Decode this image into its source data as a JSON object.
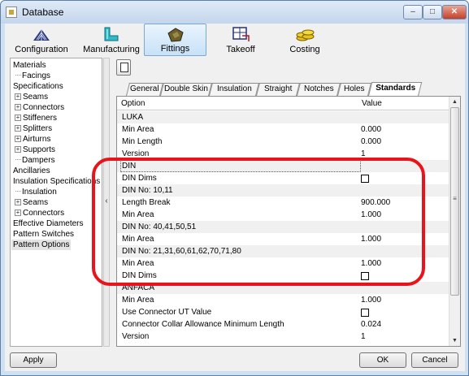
{
  "window": {
    "title": "Database",
    "controls": {
      "minimize": "–",
      "maximize": "□",
      "close": "✕"
    }
  },
  "toolbar": {
    "buttons": [
      {
        "label": "Configuration",
        "icon": "configuration-icon"
      },
      {
        "label": "Manufacturing",
        "icon": "manufacturing-icon"
      },
      {
        "label": "Fittings",
        "icon": "fittings-icon",
        "active": true
      },
      {
        "label": "Takeoff",
        "icon": "takeoff-icon"
      },
      {
        "label": "Costing",
        "icon": "costing-icon"
      }
    ]
  },
  "sidebar": {
    "items": [
      {
        "label": "Materials"
      },
      {
        "label": "Facings"
      },
      {
        "label": "Specifications"
      },
      {
        "label": "Seams"
      },
      {
        "label": "Connectors"
      },
      {
        "label": "Stiffeners"
      },
      {
        "label": "Splitters"
      },
      {
        "label": "Airturns"
      },
      {
        "label": "Supports"
      },
      {
        "label": "Dampers"
      },
      {
        "label": "Ancillaries"
      },
      {
        "label": "Insulation Specifications"
      },
      {
        "label": "Insulation"
      },
      {
        "label": "Seams"
      },
      {
        "label": "Connectors"
      },
      {
        "label": "Effective Diameters"
      },
      {
        "label": "Pattern Switches"
      },
      {
        "label": "Pattern Options",
        "selected": true
      }
    ],
    "expander_symbol": "+",
    "splitter_label": "‹"
  },
  "tabs": [
    {
      "label": "General"
    },
    {
      "label": "Double Skin"
    },
    {
      "label": "Insulation"
    },
    {
      "label": "Straight"
    },
    {
      "label": "Notches"
    },
    {
      "label": "Holes"
    },
    {
      "label": "Standards",
      "active": true
    }
  ],
  "grid": {
    "columns": {
      "option": "Option",
      "value": "Value"
    },
    "rows": [
      {
        "label": "LUKA",
        "section": true
      },
      {
        "label": "Min Area",
        "value": "0.000"
      },
      {
        "label": "Min Length",
        "value": "0.000"
      },
      {
        "label": "Version",
        "value": "1"
      },
      {
        "label": "DIN",
        "section": true
      },
      {
        "label": "DIN Dims",
        "checkbox": true
      },
      {
        "label": "DIN No: 10,11",
        "section": true
      },
      {
        "label": "Length Break",
        "value": "900.000"
      },
      {
        "label": "Min Area",
        "value": "1.000"
      },
      {
        "label": "DIN No: 40,41,50,51",
        "section": true
      },
      {
        "label": "Min Area",
        "value": "1.000"
      },
      {
        "label": "DIN No: 21,31,60,61,62,70,71,80",
        "section": true
      },
      {
        "label": "Min Area",
        "value": "1.000"
      },
      {
        "label": "DIN Dims",
        "checkbox": true
      },
      {
        "label": "ANFACA",
        "section": true
      },
      {
        "label": "Min Area",
        "value": "1.000"
      },
      {
        "label": "Use Connector UT Value",
        "checkbox": true
      },
      {
        "label": "Connector Collar Allowance Minimum Length",
        "value": "0.024"
      },
      {
        "label": "Version",
        "value": "1"
      }
    ],
    "scroll": {
      "up": "▲",
      "down": "▼",
      "grip": "≡"
    }
  },
  "footer": {
    "apply": "Apply",
    "ok": "OK",
    "cancel": "Cancel"
  },
  "colors": {
    "highlight": "#e8131b",
    "accent": "#7aa7d4"
  }
}
